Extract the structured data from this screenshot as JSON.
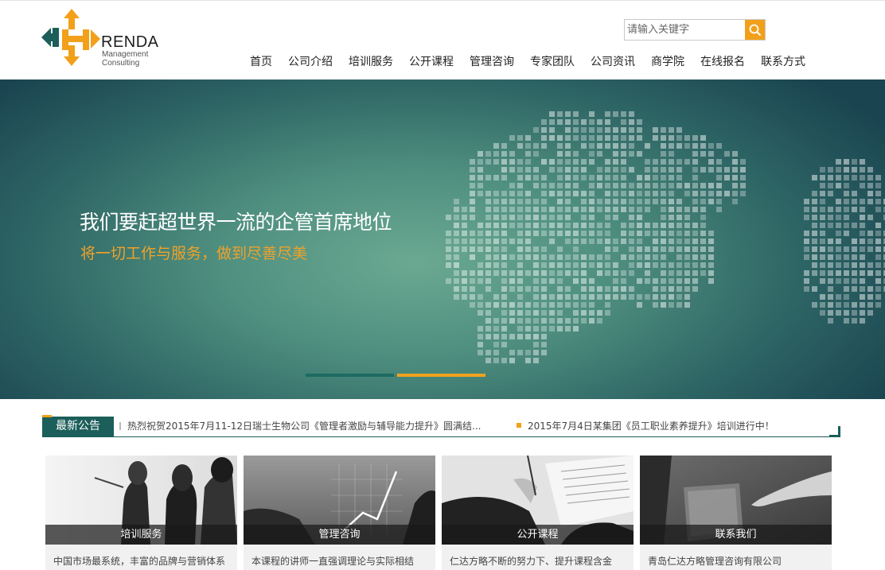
{
  "header": {
    "logo": {
      "word": "RENDA",
      "sub_line1": "Management",
      "sub_line2": "Consulting",
      "color_green": "#1b5e5a",
      "color_orange": "#f2a01a"
    },
    "search": {
      "placeholder": "请输入关键字",
      "icon": "search-icon"
    },
    "nav": [
      {
        "label": "首页"
      },
      {
        "label": "公司介绍"
      },
      {
        "label": "培训服务"
      },
      {
        "label": "公开课程"
      },
      {
        "label": "管理咨询"
      },
      {
        "label": "专家团队"
      },
      {
        "label": "公司资讯"
      },
      {
        "label": "商学院"
      },
      {
        "label": "在线报名"
      },
      {
        "label": "联系方式"
      }
    ]
  },
  "banner": {
    "title": "我们要赶超世界一流的企管首席地位",
    "subtitle": "将一切工作与服务，做到尽善尽美",
    "slides": 2,
    "active_slide": 2,
    "accent_green": "#1d6b62",
    "accent_orange": "#f0a31e"
  },
  "notice": {
    "label": "最新公告",
    "items": [
      {
        "text": "热烈祝贺2015年7月11-12日瑞士生物公司《管理者激励与辅导能力提升》圆满结..."
      },
      {
        "text": "2015年7月4日某集团《员工职业素养提升》培训进行中！"
      }
    ]
  },
  "cards": [
    {
      "caption": "培训服务",
      "desc": "中国市场最系统，丰富的品牌与营销体系"
    },
    {
      "caption": "管理咨询",
      "desc": "本课程的讲师一直强调理论与实际相结"
    },
    {
      "caption": "公开课程",
      "desc": "仁达方略不断的努力下、提升课程含金"
    },
    {
      "caption": "联系我们",
      "desc": "青岛仁达方略管理咨询有限公司"
    }
  ]
}
